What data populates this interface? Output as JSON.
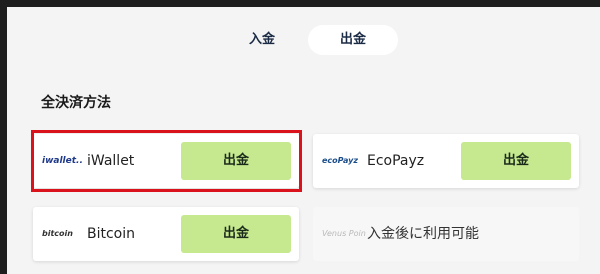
{
  "tabs": {
    "deposit_label": "入金",
    "withdraw_label": "出金"
  },
  "section": {
    "title": "全決済方法"
  },
  "methods": [
    {
      "logo_text": "iwallet..",
      "name": "iWallet",
      "button_label": "出金",
      "highlighted": true
    },
    {
      "logo_text": "ecoPayz",
      "name": "EcoPayz",
      "button_label": "出金"
    },
    {
      "logo_text": "bitcoin",
      "name": "Bitcoin",
      "button_label": "出金"
    },
    {
      "logo_text": "Venus Point",
      "name": "入金後に利用可能"
    }
  ],
  "colors": {
    "accent_button": "#c6e88f",
    "highlight_border": "#d9121b",
    "tab_text": "#1a2a44"
  }
}
